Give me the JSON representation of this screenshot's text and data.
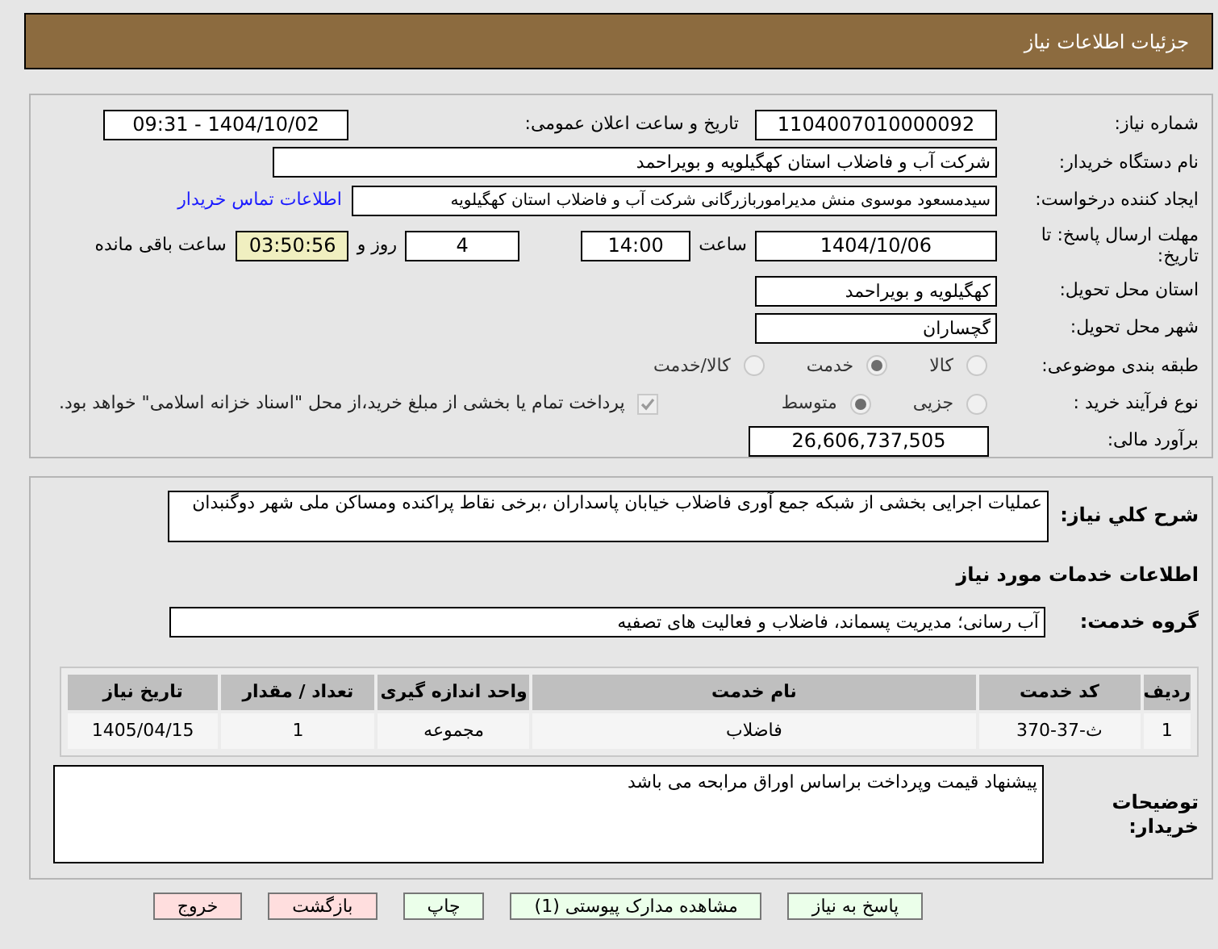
{
  "header": {
    "title": "جزئیات اطلاعات نیاز"
  },
  "need_number": {
    "label": "شماره نیاز:",
    "value": "1104007010000092"
  },
  "announce": {
    "label": "تاریخ و ساعت اعلان عمومی:",
    "value": "1404/10/02 - 09:31"
  },
  "buyer": {
    "label": "نام دستگاه خریدار:",
    "value": "شرکت آب و فاضلاب استان کهگیلویه و بویراحمد"
  },
  "creator": {
    "label": "ایجاد کننده درخواست:",
    "value": "سیدمسعود موسوی منش مدیراموربازرگانی شرکت آب و فاضلاب استان کهگیلویه",
    "link": "اطلاعات تماس خریدار"
  },
  "deadline": {
    "label": "مهلت ارسال پاسخ: تا تاریخ:",
    "date": "1404/10/06",
    "time_label": "ساعت",
    "time": "14:00",
    "days": "4",
    "days_label": "روز و",
    "remaining": "03:50:56",
    "remaining_label": "ساعت باقی مانده"
  },
  "province": {
    "label": "استان محل تحویل:",
    "value": "کهگیلویه و بویراحمد"
  },
  "city": {
    "label": "شهر محل تحویل:",
    "value": "گچساران"
  },
  "classification": {
    "label": "طبقه بندی موضوعی:",
    "options": [
      {
        "label": "کالا",
        "selected": false
      },
      {
        "label": "خدمت",
        "selected": true
      },
      {
        "label": "کالا/خدمت",
        "selected": false
      }
    ]
  },
  "process": {
    "label": "نوع فرآیند خرید :",
    "options": [
      {
        "label": "جزیی",
        "selected": false
      },
      {
        "label": "متوسط",
        "selected": true
      }
    ],
    "treasury": {
      "label": "پرداخت تمام یا بخشی از مبلغ خرید،از محل \"اسناد خزانه اسلامی\" خواهد بود.",
      "checked": true,
      "disabled": true
    }
  },
  "estimate": {
    "label": "برآورد مالی:",
    "value": "26,606,737,505"
  },
  "description": {
    "label": "شرح کلي نياز:",
    "value": "عملیات اجرایی بخشی از شبکه جمع آوری فاضلاب خیابان پاسداران ،برخی نقاط پراکنده ومساکن ملی شهر دوگنبدان"
  },
  "services_title": "اطلاعات خدمات مورد نياز",
  "service_group": {
    "label": "گروه خدمت:",
    "value": "آب رسانی؛ مدیریت پسماند، فاضلاب و فعالیت های تصفیه"
  },
  "table": {
    "columns": [
      "ردیف",
      "کد خدمت",
      "نام خدمت",
      "واحد اندازه گیری",
      "تعداد / مقدار",
      "تاریخ نیاز"
    ],
    "rows": [
      [
        "1",
        "ث-37-370",
        "فاضلاب",
        "مجموعه",
        "1",
        "1405/04/15"
      ]
    ]
  },
  "notes": {
    "label": "توضیحات خریدار:",
    "value": "پیشنهاد قیمت وپرداخت براساس اوراق مرابحه می باشد"
  },
  "buttons": [
    {
      "label": "پاسخ به نیاز",
      "kind": "action"
    },
    {
      "label": "مشاهده مدارک پیوستی (1)",
      "kind": "action"
    },
    {
      "label": "چاپ",
      "kind": "action"
    },
    {
      "label": "بازگشت",
      "kind": "cancel"
    },
    {
      "label": "خروج",
      "kind": "cancel"
    }
  ]
}
